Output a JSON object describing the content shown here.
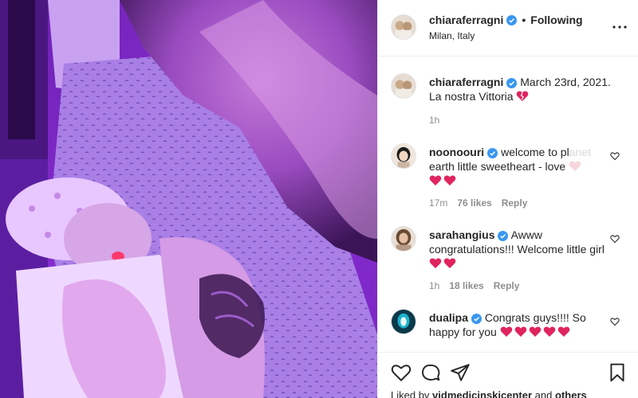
{
  "post": {
    "author": {
      "username": "chiaraferragni",
      "verified": true,
      "follow_state": "Following",
      "separator": "•",
      "location": "Milan, Italy"
    },
    "caption": {
      "username": "chiaraferragni",
      "text": "March 23rd, 2021. La nostra Vittoria",
      "time": "1h"
    },
    "comments": [
      {
        "username": "noonoouri",
        "text_visible": "welcome to pl",
        "text_faded": "anet",
        "text_line2": "earth little sweetheart - love",
        "time": "17m",
        "likes": "76 likes",
        "reply": "Reply"
      },
      {
        "username": "sarahangius",
        "text": "Awww congratulations!!! Welcome little girl",
        "time": "1h",
        "likes": "18 likes",
        "reply": "Reply"
      },
      {
        "username": "dualipa",
        "text": "Congrats guys!!!! So happy for you"
      }
    ],
    "liked_by": {
      "prefix": "Liked by",
      "user": "vidmedicinskicenter",
      "suffix": "and",
      "others": "others"
    },
    "icons": {
      "like": "heart-icon",
      "comment": "comment-icon",
      "share": "share-icon",
      "save": "bookmark-icon",
      "more": "more-options-icon",
      "verified": "verified-badge-icon"
    },
    "colors": {
      "verified_blue": "#3897f0",
      "emoji_red": "#e0245e",
      "photo_tint": "#8a2be2"
    }
  }
}
